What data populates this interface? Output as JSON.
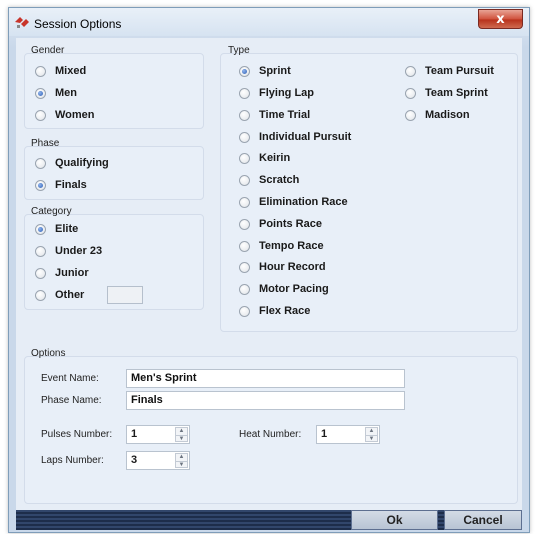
{
  "window": {
    "title": "Session Options",
    "close_glyph": "x"
  },
  "gender": {
    "label": "Gender",
    "options": [
      {
        "label": "Mixed",
        "selected": false
      },
      {
        "label": "Men",
        "selected": true
      },
      {
        "label": "Women",
        "selected": false
      }
    ]
  },
  "phase": {
    "label": "Phase",
    "options": [
      {
        "label": "Qualifying",
        "selected": false
      },
      {
        "label": "Finals",
        "selected": true
      }
    ]
  },
  "category": {
    "label": "Category",
    "options": [
      {
        "label": "Elite",
        "selected": true
      },
      {
        "label": "Under 23",
        "selected": false
      },
      {
        "label": "Junior",
        "selected": false
      },
      {
        "label": "Other",
        "selected": false
      }
    ],
    "other_value": ""
  },
  "type": {
    "label": "Type",
    "col1": [
      {
        "label": "Sprint",
        "selected": true
      },
      {
        "label": "Flying Lap",
        "selected": false
      },
      {
        "label": "Time Trial",
        "selected": false
      },
      {
        "label": "Individual Pursuit",
        "selected": false
      },
      {
        "label": "Keirin",
        "selected": false
      },
      {
        "label": "Scratch",
        "selected": false
      },
      {
        "label": "Elimination Race",
        "selected": false
      },
      {
        "label": "Points Race",
        "selected": false
      },
      {
        "label": "Tempo Race",
        "selected": false
      },
      {
        "label": "Hour Record",
        "selected": false
      },
      {
        "label": "Motor Pacing",
        "selected": false
      },
      {
        "label": "Flex Race",
        "selected": false
      }
    ],
    "col2": [
      {
        "label": "Team Pursuit",
        "selected": false
      },
      {
        "label": "Team Sprint",
        "selected": false
      },
      {
        "label": "Madison",
        "selected": false
      }
    ]
  },
  "options": {
    "label": "Options",
    "event_name_label": "Event Name:",
    "event_name_value": "Men's Sprint",
    "phase_name_label": "Phase Name:",
    "phase_name_value": "Finals",
    "pulses_label": "Pulses Number:",
    "pulses_value": "1",
    "heat_label": "Heat Number:",
    "heat_value": "1",
    "laps_label": "Laps Number:",
    "laps_value": "3"
  },
  "footer": {
    "ok_label": "Ok",
    "cancel_label": "Cancel"
  },
  "colors": {
    "selected_radio": "#2e5fb3",
    "title_close": "#c8432c",
    "footer_bar": "#2a3b5c"
  }
}
